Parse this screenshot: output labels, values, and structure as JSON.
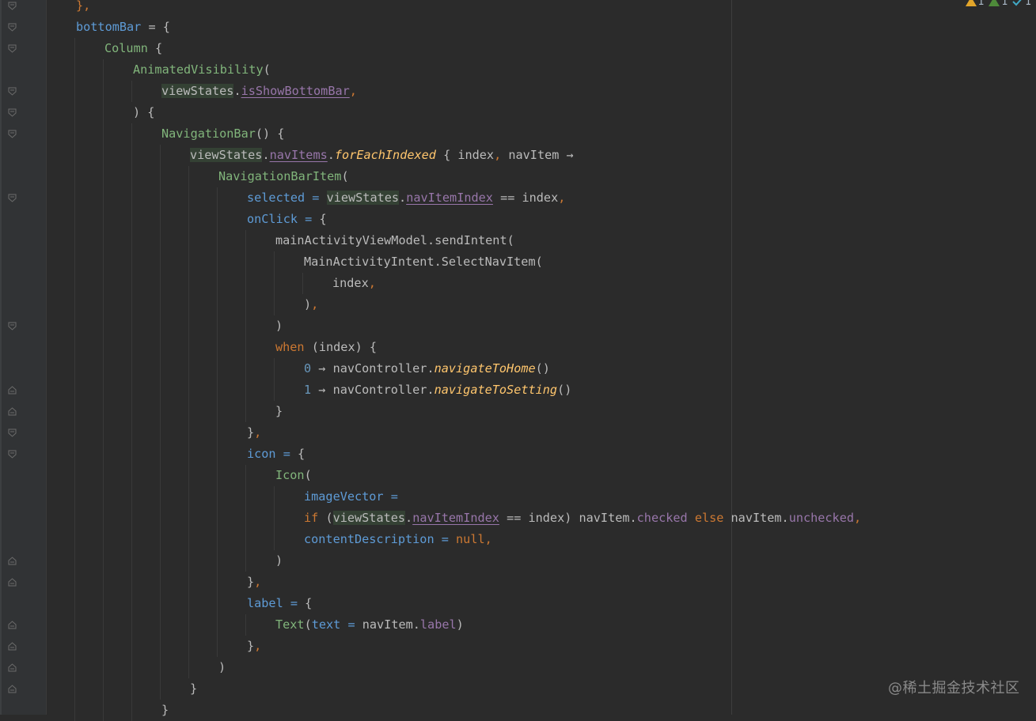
{
  "inspections": {
    "warnings": "1",
    "weak_warnings": "1",
    "typos": "1"
  },
  "watermark": "@稀土掘金技术社区",
  "colors": {
    "background": "#2b2b2b",
    "gutter": "#313335",
    "keyword": "#cc7832",
    "property": "#9876aa",
    "parameter": "#5e9bd6",
    "function": "#81b57b",
    "extension": "#ffc66d",
    "number": "#6897bb"
  },
  "code_lines": [
    {
      "indent": 1,
      "tokens": [
        {
          "t": "},",
          "c": "tok-kw"
        }
      ]
    },
    {
      "indent": 1,
      "tokens": [
        {
          "t": "bottomBar",
          "c": "tok-param"
        },
        {
          "t": " = {",
          "c": "tok-plain"
        }
      ]
    },
    {
      "indent": 2,
      "tokens": [
        {
          "t": "Column",
          "c": "tok-fn"
        },
        {
          "t": " {",
          "c": "tok-plain"
        }
      ]
    },
    {
      "indent": 3,
      "tokens": [
        {
          "t": "AnimatedVisibility",
          "c": "tok-fn"
        },
        {
          "t": "(",
          "c": "tok-plain"
        }
      ]
    },
    {
      "indent": 4,
      "tokens": [
        {
          "t": "viewStates",
          "c": "tok-plain tok-hl"
        },
        {
          "t": ".",
          "c": "tok-plain"
        },
        {
          "t": "isShowBottomBar",
          "c": "tok-prop tok-ul"
        },
        {
          "t": ",",
          "c": "tok-kw"
        }
      ]
    },
    {
      "indent": 3,
      "tokens": [
        {
          "t": ") {",
          "c": "tok-plain"
        }
      ]
    },
    {
      "indent": 4,
      "tokens": [
        {
          "t": "NavigationBar",
          "c": "tok-fn"
        },
        {
          "t": "() {",
          "c": "tok-plain"
        }
      ]
    },
    {
      "indent": 5,
      "tokens": [
        {
          "t": "viewStates",
          "c": "tok-plain tok-hl"
        },
        {
          "t": ".",
          "c": "tok-plain"
        },
        {
          "t": "navItems",
          "c": "tok-prop tok-ul"
        },
        {
          "t": ".",
          "c": "tok-plain"
        },
        {
          "t": "forEachIndexed",
          "c": "tok-ext"
        },
        {
          "t": " { index",
          "c": "tok-plain"
        },
        {
          "t": ",",
          "c": "tok-kw"
        },
        {
          "t": " navItem →",
          "c": "tok-plain"
        }
      ]
    },
    {
      "indent": 6,
      "tokens": [
        {
          "t": "NavigationBarItem",
          "c": "tok-fn"
        },
        {
          "t": "(",
          "c": "tok-plain"
        }
      ]
    },
    {
      "indent": 7,
      "tokens": [
        {
          "t": "selected",
          "c": "tok-param"
        },
        {
          "t": " = ",
          "c": "tok-param"
        },
        {
          "t": "viewStates",
          "c": "tok-plain tok-hl"
        },
        {
          "t": ".",
          "c": "tok-plain"
        },
        {
          "t": "navItemIndex",
          "c": "tok-prop tok-ul"
        },
        {
          "t": " == index",
          "c": "tok-plain"
        },
        {
          "t": ",",
          "c": "tok-kw"
        }
      ]
    },
    {
      "indent": 7,
      "tokens": [
        {
          "t": "onClick",
          "c": "tok-param"
        },
        {
          "t": " = ",
          "c": "tok-param"
        },
        {
          "t": "{",
          "c": "tok-plain"
        }
      ]
    },
    {
      "indent": 8,
      "tokens": [
        {
          "t": "mainActivityViewModel.sendIntent(",
          "c": "tok-plain"
        }
      ]
    },
    {
      "indent": 9,
      "tokens": [
        {
          "t": "MainActivityIntent.SelectNavItem(",
          "c": "tok-plain"
        }
      ]
    },
    {
      "indent": 10,
      "tokens": [
        {
          "t": "index",
          "c": "tok-plain"
        },
        {
          "t": ",",
          "c": "tok-kw"
        }
      ]
    },
    {
      "indent": 9,
      "tokens": [
        {
          "t": ")",
          "c": "tok-plain"
        },
        {
          "t": ",",
          "c": "tok-kw"
        }
      ]
    },
    {
      "indent": 8,
      "tokens": [
        {
          "t": ")",
          "c": "tok-plain"
        }
      ]
    },
    {
      "indent": 8,
      "tokens": [
        {
          "t": "when",
          "c": "tok-kw"
        },
        {
          "t": " (index) {",
          "c": "tok-plain"
        }
      ]
    },
    {
      "indent": 9,
      "tokens": [
        {
          "t": "0",
          "c": "tok-num"
        },
        {
          "t": " → navController.",
          "c": "tok-plain"
        },
        {
          "t": "navigateToHome",
          "c": "tok-ext"
        },
        {
          "t": "()",
          "c": "tok-plain"
        }
      ]
    },
    {
      "indent": 9,
      "tokens": [
        {
          "t": "1",
          "c": "tok-num"
        },
        {
          "t": " → navController.",
          "c": "tok-plain"
        },
        {
          "t": "navigateToSetting",
          "c": "tok-ext"
        },
        {
          "t": "()",
          "c": "tok-plain"
        }
      ]
    },
    {
      "indent": 8,
      "tokens": [
        {
          "t": "}",
          "c": "tok-plain"
        }
      ]
    },
    {
      "indent": 7,
      "tokens": [
        {
          "t": "}",
          "c": "tok-plain"
        },
        {
          "t": ",",
          "c": "tok-kw"
        }
      ]
    },
    {
      "indent": 7,
      "tokens": [
        {
          "t": "icon",
          "c": "tok-param"
        },
        {
          "t": " = ",
          "c": "tok-param"
        },
        {
          "t": "{",
          "c": "tok-plain"
        }
      ]
    },
    {
      "indent": 8,
      "tokens": [
        {
          "t": "Icon",
          "c": "tok-fn"
        },
        {
          "t": "(",
          "c": "tok-plain"
        }
      ]
    },
    {
      "indent": 9,
      "tokens": [
        {
          "t": "imageVector",
          "c": "tok-param"
        },
        {
          "t": " =",
          "c": "tok-param"
        }
      ]
    },
    {
      "indent": 9,
      "tokens": [
        {
          "t": "if",
          "c": "tok-kw"
        },
        {
          "t": " (",
          "c": "tok-plain"
        },
        {
          "t": "viewStates",
          "c": "tok-plain tok-hl"
        },
        {
          "t": ".",
          "c": "tok-plain"
        },
        {
          "t": "navItemIndex",
          "c": "tok-prop tok-ul"
        },
        {
          "t": " == index) navItem.",
          "c": "tok-plain"
        },
        {
          "t": "checked",
          "c": "tok-prop"
        },
        {
          "t": " else",
          "c": "tok-kw"
        },
        {
          "t": " navItem.",
          "c": "tok-plain"
        },
        {
          "t": "unchecked",
          "c": "tok-prop"
        },
        {
          "t": ",",
          "c": "tok-kw"
        }
      ]
    },
    {
      "indent": 9,
      "tokens": [
        {
          "t": "contentDescription",
          "c": "tok-param"
        },
        {
          "t": " = ",
          "c": "tok-param"
        },
        {
          "t": "null",
          "c": "tok-kw"
        },
        {
          "t": ",",
          "c": "tok-kw"
        }
      ]
    },
    {
      "indent": 8,
      "tokens": [
        {
          "t": ")",
          "c": "tok-plain"
        }
      ]
    },
    {
      "indent": 7,
      "tokens": [
        {
          "t": "}",
          "c": "tok-plain"
        },
        {
          "t": ",",
          "c": "tok-kw"
        }
      ]
    },
    {
      "indent": 7,
      "tokens": [
        {
          "t": "label",
          "c": "tok-param"
        },
        {
          "t": " = ",
          "c": "tok-param"
        },
        {
          "t": "{",
          "c": "tok-plain"
        }
      ]
    },
    {
      "indent": 8,
      "tokens": [
        {
          "t": "Text",
          "c": "tok-fn"
        },
        {
          "t": "(",
          "c": "tok-plain"
        },
        {
          "t": "text",
          "c": "tok-param"
        },
        {
          "t": " = ",
          "c": "tok-param"
        },
        {
          "t": "navItem.",
          "c": "tok-plain"
        },
        {
          "t": "label",
          "c": "tok-prop"
        },
        {
          "t": ")",
          "c": "tok-plain"
        }
      ]
    },
    {
      "indent": 7,
      "tokens": [
        {
          "t": "}",
          "c": "tok-plain"
        },
        {
          "t": ",",
          "c": "tok-kw"
        }
      ]
    },
    {
      "indent": 6,
      "tokens": [
        {
          "t": ")",
          "c": "tok-plain"
        }
      ]
    },
    {
      "indent": 5,
      "tokens": [
        {
          "t": "}",
          "c": "tok-plain"
        }
      ]
    },
    {
      "indent": 4,
      "tokens": [
        {
          "t": "}",
          "c": "tok-plain"
        }
      ]
    }
  ]
}
